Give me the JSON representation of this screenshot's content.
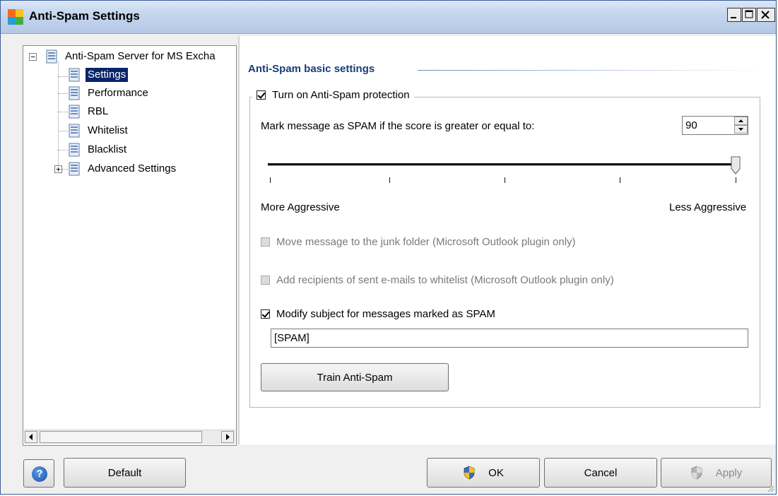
{
  "window": {
    "title": "Anti-Spam Settings"
  },
  "tree": {
    "root_label": "Anti-Spam Server for MS Excha",
    "root_expander": "−",
    "advanced_expander": "+",
    "items": [
      {
        "label": "Settings",
        "selected": true
      },
      {
        "label": "Performance",
        "selected": false
      },
      {
        "label": "RBL",
        "selected": false
      },
      {
        "label": "Whitelist",
        "selected": false
      },
      {
        "label": "Blacklist",
        "selected": false
      },
      {
        "label": "Advanced Settings",
        "selected": false
      }
    ]
  },
  "panel": {
    "section_title": "Anti-Spam basic settings",
    "protection_checkbox": {
      "label": "Turn on Anti-Spam protection",
      "checked": true
    },
    "score_label": "Mark message as SPAM if the score is greater or equal to:",
    "score_value": "90",
    "slider": {
      "value": 90,
      "tick_count": 5,
      "min_label": "More Aggressive",
      "max_label": "Less Aggressive"
    },
    "move_junk": {
      "label": "Move message to the junk folder (Microsoft Outlook plugin only)",
      "checked": false,
      "enabled": false
    },
    "add_recipients": {
      "label": "Add recipients of sent e-mails to whitelist (Microsoft Outlook plugin only)",
      "checked": false,
      "enabled": false
    },
    "modify_subject": {
      "label": "Modify subject for messages marked as SPAM",
      "checked": true
    },
    "subject_value": "[SPAM]",
    "train_button": "Train Anti-Spam"
  },
  "footer": {
    "help_icon_text": "?",
    "default_button": "Default",
    "ok_button": "OK",
    "cancel_button": "Cancel",
    "apply_button": "Apply"
  },
  "colors": {
    "selection": "#0a246a",
    "section_title": "#1a3c78",
    "titlebar": "#c5d6ee"
  }
}
